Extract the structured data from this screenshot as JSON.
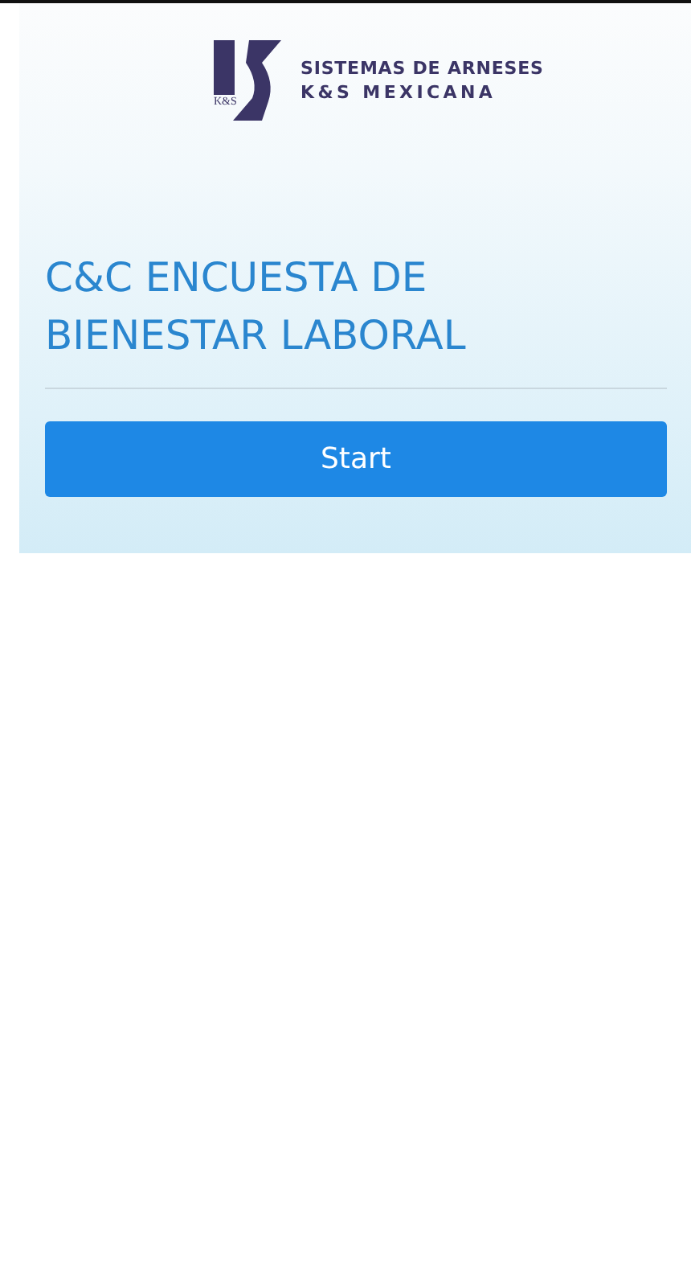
{
  "logo": {
    "mark": "K&S",
    "line_1": "SISTEMAS DE ARNESES",
    "line_2": "K&S MEXICANA"
  },
  "title": "C&C ENCUESTA DE BIENESTAR LABORAL",
  "start_button": {
    "label": "Start"
  }
}
